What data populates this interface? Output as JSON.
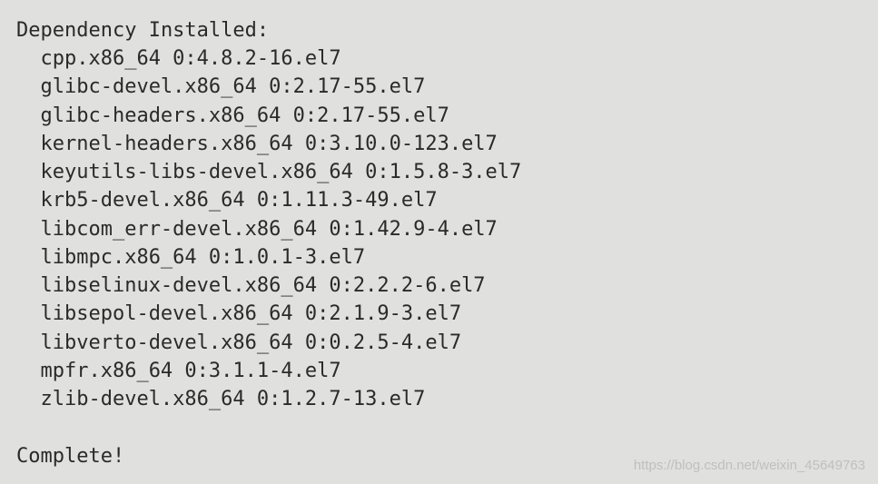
{
  "header": "Dependency Installed:",
  "packages": [
    "cpp.x86_64 0:4.8.2-16.el7",
    "glibc-devel.x86_64 0:2.17-55.el7",
    "glibc-headers.x86_64 0:2.17-55.el7",
    "kernel-headers.x86_64 0:3.10.0-123.el7",
    "keyutils-libs-devel.x86_64 0:1.5.8-3.el7",
    "krb5-devel.x86_64 0:1.11.3-49.el7",
    "libcom_err-devel.x86_64 0:1.42.9-4.el7",
    "libmpc.x86_64 0:1.0.1-3.el7",
    "libselinux-devel.x86_64 0:2.2.2-6.el7",
    "libsepol-devel.x86_64 0:2.1.9-3.el7",
    "libverto-devel.x86_64 0:0.2.5-4.el7",
    "mpfr.x86_64 0:3.1.1-4.el7",
    "zlib-devel.x86_64 0:1.2.7-13.el7"
  ],
  "complete": "Complete!",
  "watermark": "https://blog.csdn.net/weixin_45649763"
}
